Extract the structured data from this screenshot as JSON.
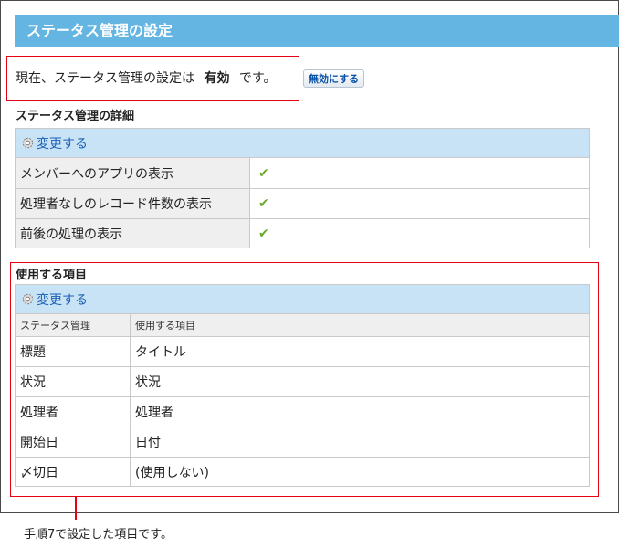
{
  "page": {
    "title": "ステータス管理の設定"
  },
  "status": {
    "prefix": "現在、ステータス管理の設定は",
    "value": "有効",
    "suffix": "です。",
    "disable_button_label": "無効にする"
  },
  "details": {
    "heading": "ステータス管理の詳細",
    "change_label": "変更する",
    "rows": [
      {
        "label": "メンバーへのアプリの表示",
        "enabled": true
      },
      {
        "label": "処理者なしのレコード件数の表示",
        "enabled": true
      },
      {
        "label": "前後の処理の表示",
        "enabled": true
      }
    ]
  },
  "items": {
    "heading": "使用する項目",
    "change_label": "変更する",
    "columns": [
      "ステータス管理",
      "使用する項目"
    ],
    "rows": [
      {
        "status_field": "標題",
        "used_field": "タイトル"
      },
      {
        "status_field": "状況",
        "used_field": "状況"
      },
      {
        "status_field": "処理者",
        "used_field": "処理者"
      },
      {
        "status_field": "開始日",
        "used_field": "日付"
      },
      {
        "status_field": "〆切日",
        "used_field": "(使用しない)"
      }
    ]
  },
  "annotation": {
    "caption": "手順7で設定した項目です。",
    "highlight_color": "#e60012"
  },
  "icons": {
    "change": "gear-icon",
    "enabled": "check-icon"
  },
  "colors": {
    "title_bar": "#64b5e1",
    "panel_header": "#c9e3f6",
    "link": "#1a5fb4",
    "check": "#6aa82a"
  }
}
